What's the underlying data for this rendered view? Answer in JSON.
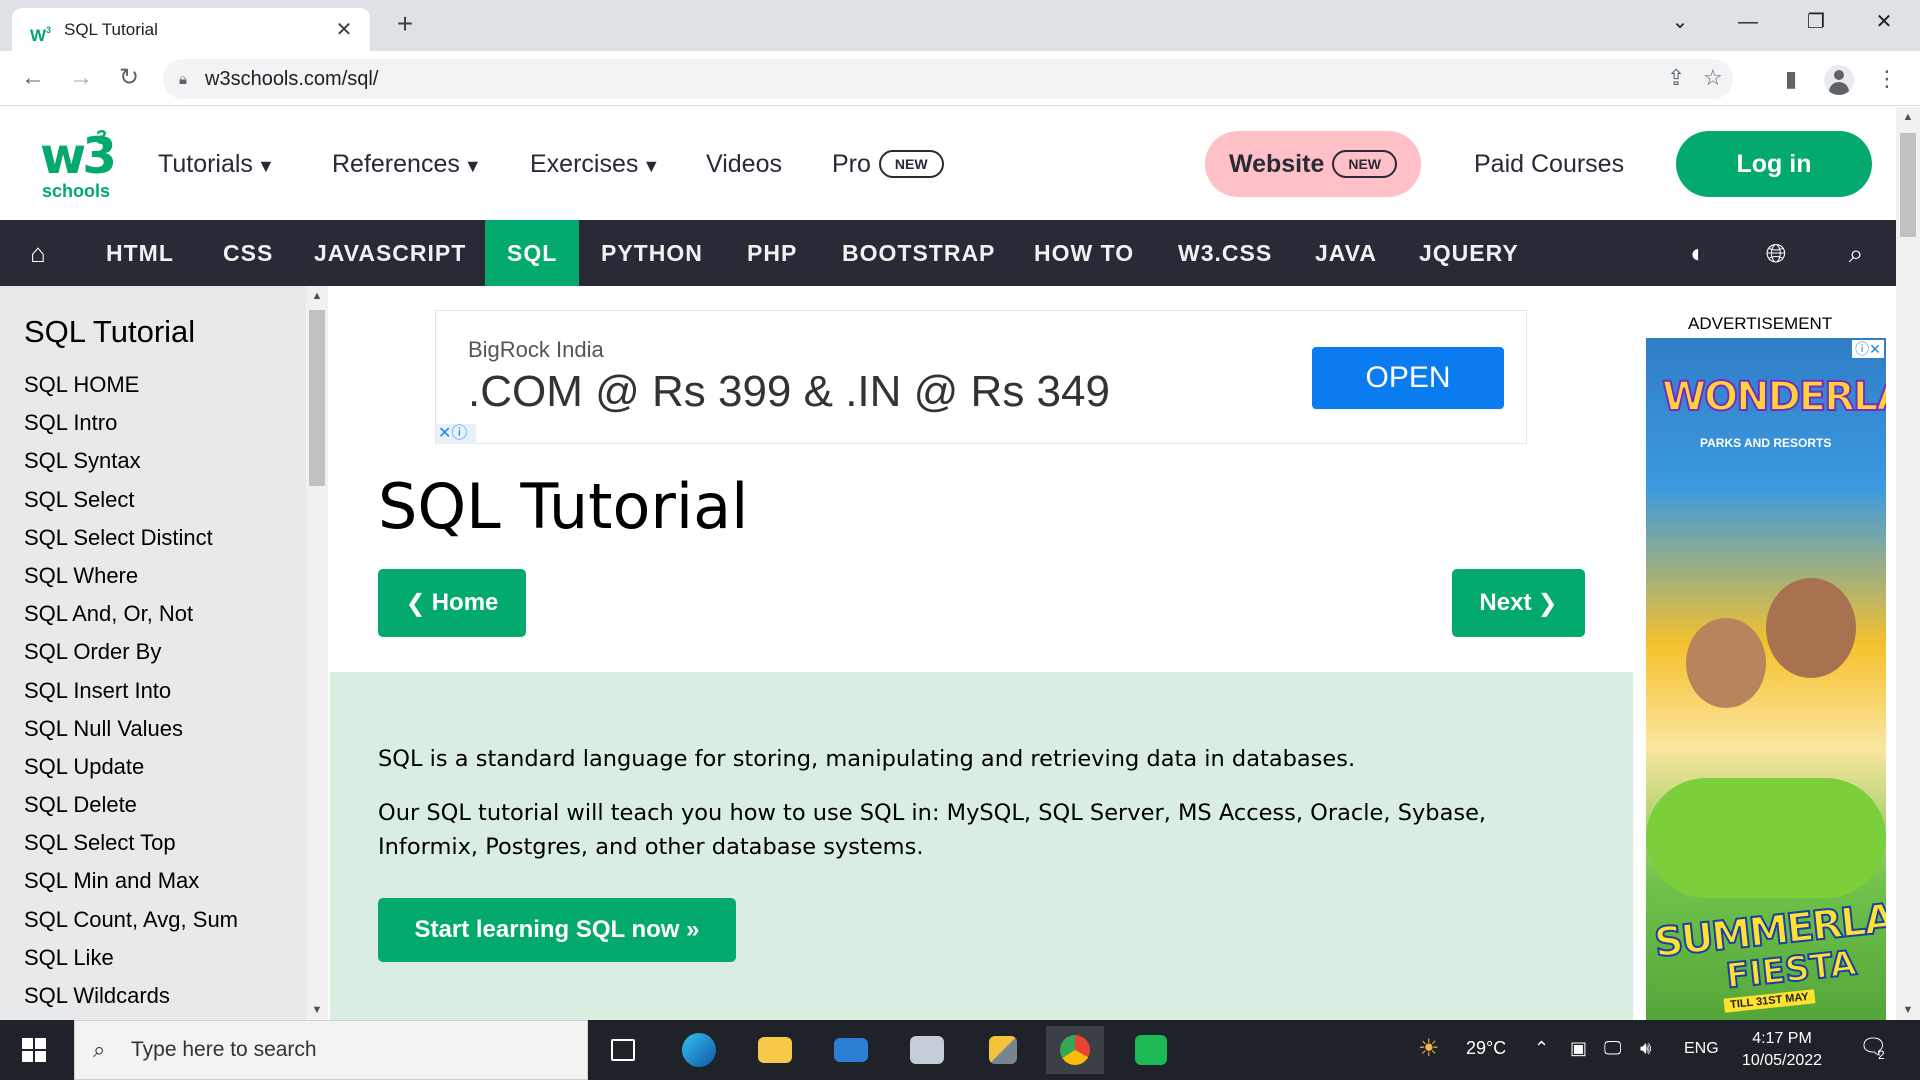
{
  "browser": {
    "tab_title": "SQL Tutorial",
    "url": "w3schools.com/sql/"
  },
  "site": {
    "logo_w3": "w3",
    "logo_sup": "3",
    "logo_schools": "schools",
    "topnav": {
      "tutorials": "Tutorials",
      "references": "References",
      "exercises": "Exercises",
      "videos": "Videos",
      "pro": "Pro",
      "pro_badge": "NEW",
      "website": "Website",
      "website_badge": "NEW",
      "paid_courses": "Paid Courses",
      "login": "Log in"
    },
    "subnav": [
      "HTML",
      "CSS",
      "JAVASCRIPT",
      "SQL",
      "PYTHON",
      "PHP",
      "BOOTSTRAP",
      "HOW TO",
      "W3.CSS",
      "JAVA",
      "JQUERY"
    ],
    "subnav_active": "SQL"
  },
  "sidebar": {
    "title": "SQL Tutorial",
    "items": [
      "SQL HOME",
      "SQL Intro",
      "SQL Syntax",
      "SQL Select",
      "SQL Select Distinct",
      "SQL Where",
      "SQL And, Or, Not",
      "SQL Order By",
      "SQL Insert Into",
      "SQL Null Values",
      "SQL Update",
      "SQL Delete",
      "SQL Select Top",
      "SQL Min and Max",
      "SQL Count, Avg, Sum",
      "SQL Like",
      "SQL Wildcards"
    ]
  },
  "ad_top": {
    "brand": "BigRock India",
    "headline": ".COM @ Rs 399 & .IN @ Rs 349",
    "cta": "OPEN"
  },
  "main": {
    "title": "SQL Tutorial",
    "home_button": "Home",
    "next_button": "Next",
    "para1": "SQL is a standard language for storing, manipulating and retrieving data in databases.",
    "para2": "Our SQL tutorial will teach you how to use SQL in: MySQL, SQL Server, MS Access, Oracle, Sybase, Informix, Postgres, and other database systems.",
    "start_button": "Start learning SQL now »"
  },
  "ad_side": {
    "label": "ADVERTISEMENT",
    "brand": "WONDERLA",
    "brand_sub": "PARKS AND RESORTS",
    "promo1": "SUMMERLA",
    "promo2": "FIESTA",
    "promo_date": "TILL 31ST MAY"
  },
  "taskbar": {
    "search_placeholder": "Type here to search",
    "temperature": "29°C",
    "language": "ENG",
    "time": "4:17 PM",
    "date": "10/05/2022",
    "notifications": "2"
  },
  "colors": {
    "w3_green": "#04aa6d",
    "nav_dark": "#282a35",
    "website_pink": "#ffc0c7",
    "sidebar_bg": "#e7e9eb",
    "intro_bg": "#d9eee1",
    "ad_blue": "#0a7cf0"
  }
}
